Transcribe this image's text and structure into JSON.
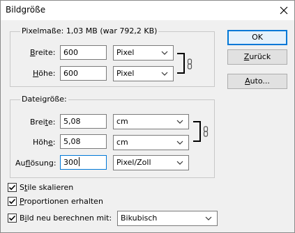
{
  "window": {
    "title": "Bildgröße",
    "close_icon": "close-icon"
  },
  "pixel_dimensions": {
    "legend_prefix": "Pixelmaße:",
    "legend_value": "1,03 MB (war 792,2 KB)",
    "width_label_before": "B",
    "width_label_after": "reite:",
    "width_value": "600",
    "width_unit": "Pixel",
    "height_label_before": "H",
    "height_label_after": "öhe:",
    "height_value": "600",
    "height_unit": "Pixel",
    "link_icon": "chain-link-icon"
  },
  "document_size": {
    "legend": "Dateigröße:",
    "width_label_before": "Brei",
    "width_label_u": "t",
    "width_label_after": "e:",
    "width_value": "5,08",
    "width_unit": "cm",
    "height_label_before": "Höh",
    "height_label_u": "e",
    "height_label_after": ":",
    "height_value": "5,08",
    "height_unit": "cm",
    "resolution_label_before": "Au",
    "resolution_label_u": "f",
    "resolution_label_after": "lösung:",
    "resolution_value": "300",
    "resolution_unit": "Pixel/Zoll",
    "link_icon": "chain-link-icon"
  },
  "buttons": {
    "ok": "OK",
    "reset_before": "",
    "reset_u": "Z",
    "reset_after": "urück",
    "auto_before": "",
    "auto_u": "A",
    "auto_after": "uto..."
  },
  "options": {
    "scale_styles_before": "S",
    "scale_styles_u": "t",
    "scale_styles_after": "ile skalieren",
    "scale_styles_checked": true,
    "constrain_u": "P",
    "constrain_after": "roportionen erhalten",
    "constrain_checked": true,
    "resample_before": "B",
    "resample_u": "i",
    "resample_after": "ld neu berechnen mit:",
    "resample_checked": true,
    "resample_method": "Bikubisch"
  }
}
